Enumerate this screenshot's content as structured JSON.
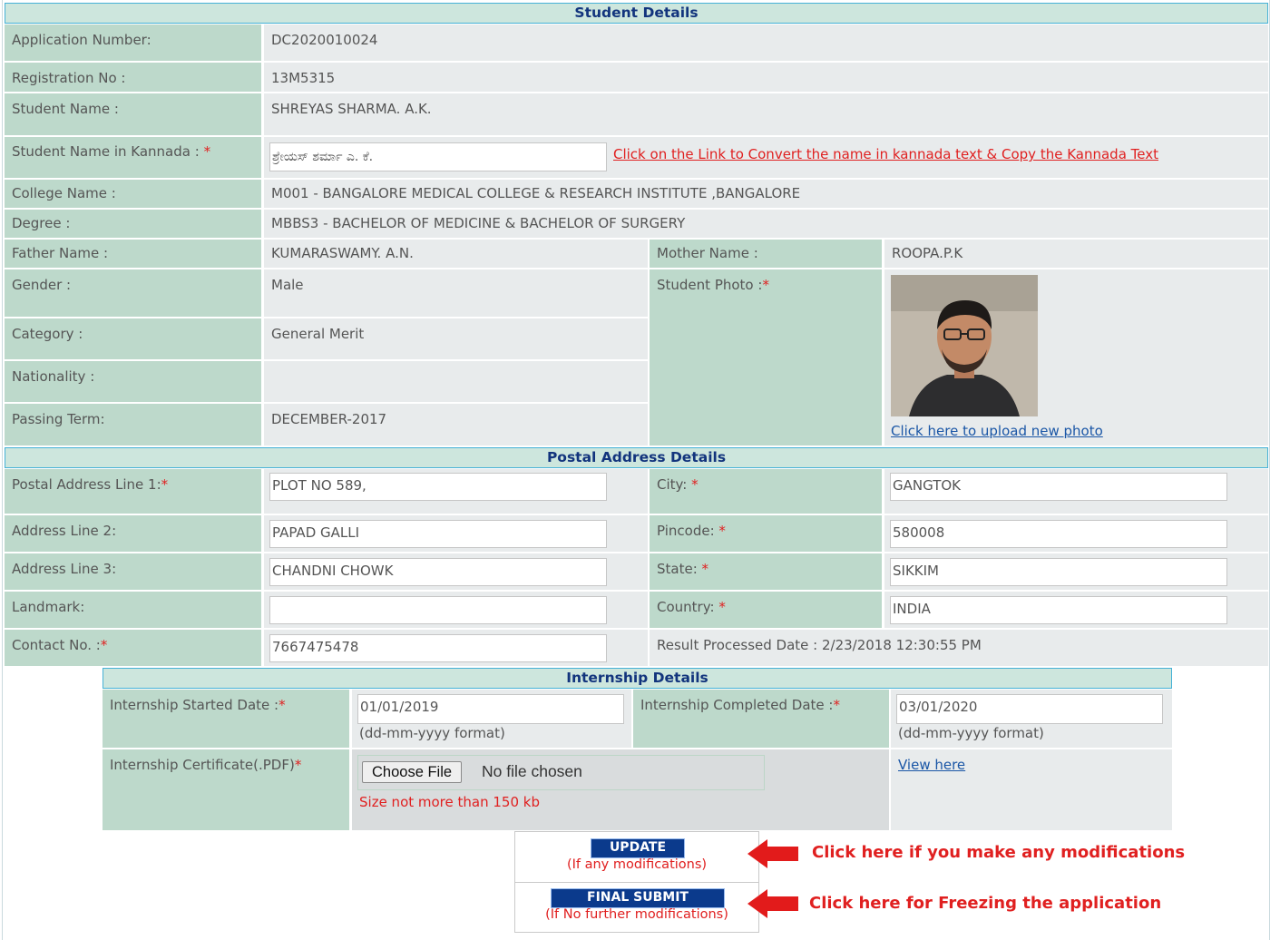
{
  "student": {
    "header": "Student Details",
    "app_no_label": "Application Number:",
    "app_no_value": "DC2020010024",
    "reg_no_label": "Registration No :",
    "reg_no_value": "13M5315",
    "name_label": "Student Name :",
    "name_value": "SHREYAS SHARMA. A.K.",
    "kannada_label": "Student Name in Kannada :",
    "kannada_value": "ಶ್ರೇಯಸ್ ಶರ್ಮಾ ಎ. ಕೆ.",
    "kannada_link": "Click on the Link to Convert the name in kannada text & Copy the Kannada Text",
    "college_label": "College Name :",
    "college_value": "M001 - BANGALORE MEDICAL COLLEGE & RESEARCH INSTITUTE ,BANGALORE",
    "degree_label": "Degree :",
    "degree_value": "MBBS3 - BACHELOR OF MEDICINE & BACHELOR OF SURGERY",
    "father_label": "Father Name :",
    "father_value": "KUMARASWAMY. A.N.",
    "mother_label": "Mother Name :",
    "mother_value": "ROOPA.P.K",
    "gender_label": "Gender :",
    "gender_value": "Male",
    "photo_label": "Student Photo :",
    "photo_link": "Click here to upload new photo",
    "category_label": "Category :",
    "category_value": "General Merit",
    "nationality_label": "Nationality :",
    "nationality_value": "",
    "passing_label": "Passing Term:",
    "passing_value": "DECEMBER-2017",
    "required_mark": "*"
  },
  "postal": {
    "header": "Postal Address Details",
    "line1_label": "Postal Address Line 1:",
    "line1_value": "PLOT NO 589,",
    "line2_label": "Address Line 2:",
    "line2_value": "PAPAD GALLI",
    "line3_label": "Address Line 3:",
    "line3_value": "CHANDNI CHOWK",
    "landmark_label": "Landmark:",
    "landmark_value": "",
    "contact_label": "Contact No. :",
    "contact_value": "7667475478",
    "city_label": "City:",
    "city_value": "GANGTOK",
    "pincode_label": "Pincode:",
    "pincode_value": "580008",
    "state_label": "State:",
    "state_value": "SIKKIM",
    "country_label": "Country:",
    "country_value": "INDIA",
    "result_processed": "Result Processed Date : 2/23/2018 12:30:55 PM"
  },
  "internship": {
    "header": "Internship Details",
    "started_label": "Internship Started Date :",
    "started_value": "01/01/2019",
    "completed_label": "Internship Completed Date :",
    "completed_value": "03/01/2020",
    "date_format_hint": "(dd-mm-yyyy format)",
    "cert_label": "Internship Certificate(.PDF)",
    "choose_file": "Choose File",
    "no_file": "No file chosen",
    "size_hint": "Size not more than 150 kb",
    "view_link": "View here"
  },
  "actions": {
    "update_label": "UPDATE",
    "update_hint": "(If any modifications)",
    "final_label": "FINAL SUBMIT",
    "final_hint": "(If No further modifications)",
    "update_note": "Click here if you make any modifications",
    "final_note": "Click here for Freezing the application"
  },
  "colors": {
    "label_bg": "#bdd9cb",
    "value_bg": "#e8ebec",
    "header_bg": "#cde6dd",
    "header_border": "#45b1d6",
    "header_text": "#12347d",
    "required": "#e02020",
    "button_bg": "#0b3a8c"
  }
}
